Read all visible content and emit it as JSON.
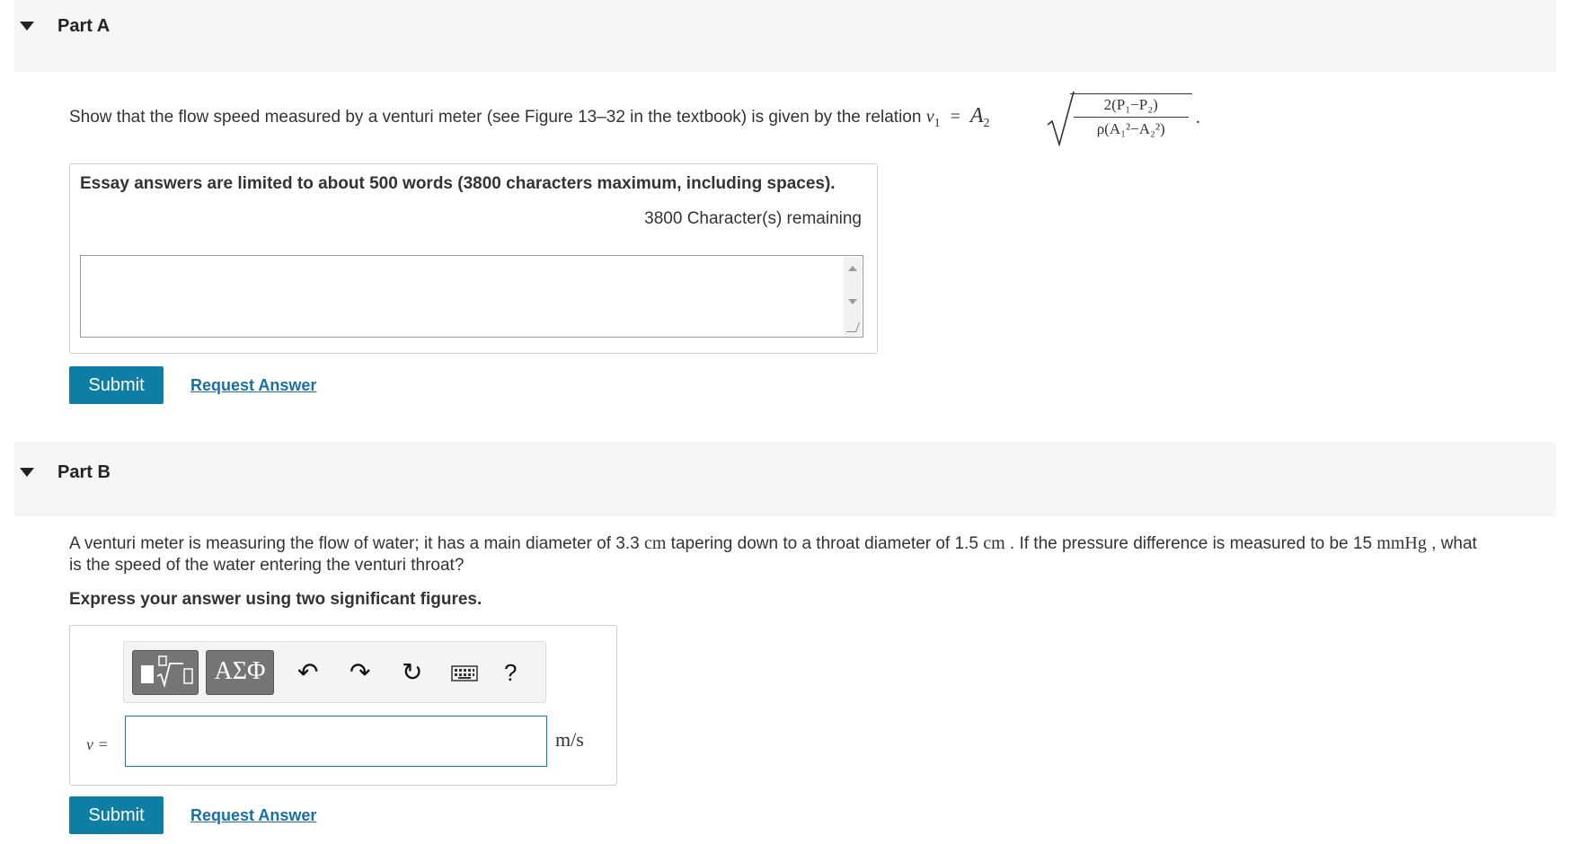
{
  "partA": {
    "title": "Part A",
    "question_prefix": "Show that the flow speed measured by a venturi meter (see Figure 13–32 in the textbook) is given by the relation ",
    "formula": {
      "lhs": "v",
      "lhs_sub": "1",
      "equals": "=",
      "coef": "A",
      "coef_sub": "2",
      "numerator": "2(P₁−P₂)",
      "denominator": "ρ(A₁²−A₂²)",
      "end": "."
    },
    "essay_note": "Essay answers are limited to about 500 words (3800 characters maximum, including spaces).",
    "remaining": "3800 Character(s) remaining",
    "essay_value": "",
    "submit_label": "Submit",
    "request_label": "Request Answer"
  },
  "partB": {
    "title": "Part B",
    "question_line1": {
      "t1": "A venturi meter is measuring the flow of water; it has a main diameter of 3.3 ",
      "u1": "cm",
      "t2": " tapering down to a throat diameter of 1.5 ",
      "u2": "cm",
      "t3": " . If the pressure difference is measured to be 15 ",
      "u3": "mmHg",
      "t4": " , what"
    },
    "question_line2": "is the speed of the water entering the venturi throat?",
    "instruction": "Express your answer using two significant figures.",
    "toolbar": {
      "greek_label": "ΑΣΦ",
      "undo_icon": "↶",
      "redo_icon": "↷",
      "reset_icon": "↻",
      "help_label": "?"
    },
    "variable_label": "v =",
    "answer_value": "",
    "unit": "m/s",
    "submit_label": "Submit",
    "request_label": "Request Answer"
  }
}
